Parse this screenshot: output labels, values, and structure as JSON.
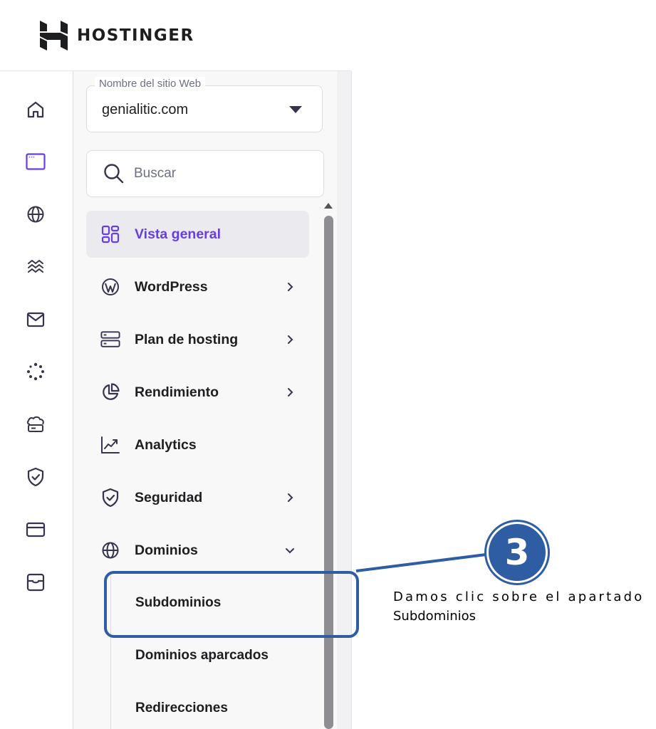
{
  "brand": {
    "name": "HOSTINGER",
    "logo_icon": "hostinger-h-logo"
  },
  "rail": {
    "icons": [
      "home-icon",
      "browser-window-icon",
      "globe-icon",
      "waves-icon",
      "mail-icon",
      "loader-icon",
      "cloud-server-icon",
      "shield-icon",
      "credit-card-icon",
      "store-icon"
    ],
    "active": "browser-window-icon"
  },
  "site_select": {
    "label": "Nombre del sitio Web",
    "value": "genialitic.com"
  },
  "search": {
    "placeholder": "Buscar"
  },
  "menu": {
    "items": [
      {
        "label": "Vista general",
        "icon": "dashboard-grid-icon",
        "active": true,
        "chevron": "none"
      },
      {
        "label": "WordPress",
        "icon": "wordpress-icon",
        "chevron": "right"
      },
      {
        "label": "Plan de hosting",
        "icon": "server-icon",
        "chevron": "right"
      },
      {
        "label": "Rendimiento",
        "icon": "pie-chart-icon",
        "chevron": "right"
      },
      {
        "label": "Analytics",
        "icon": "analytics-chart-icon",
        "chevron": "none"
      },
      {
        "label": "Seguridad",
        "icon": "shield-icon",
        "chevron": "right"
      },
      {
        "label": "Dominios",
        "icon": "globe-icon",
        "chevron": "down"
      }
    ],
    "sub_items": [
      "Subdominios",
      "Dominios aparcados",
      "Redirecciones"
    ]
  },
  "annotation": {
    "step": "3",
    "caption_line1": "Damos clic sobre el apartado",
    "caption_line2": "Subdominios",
    "color": "#2e5da4"
  },
  "colors": {
    "accent": "#673de6",
    "active_bg": "#ebebef",
    "text": "#1d1e20"
  }
}
